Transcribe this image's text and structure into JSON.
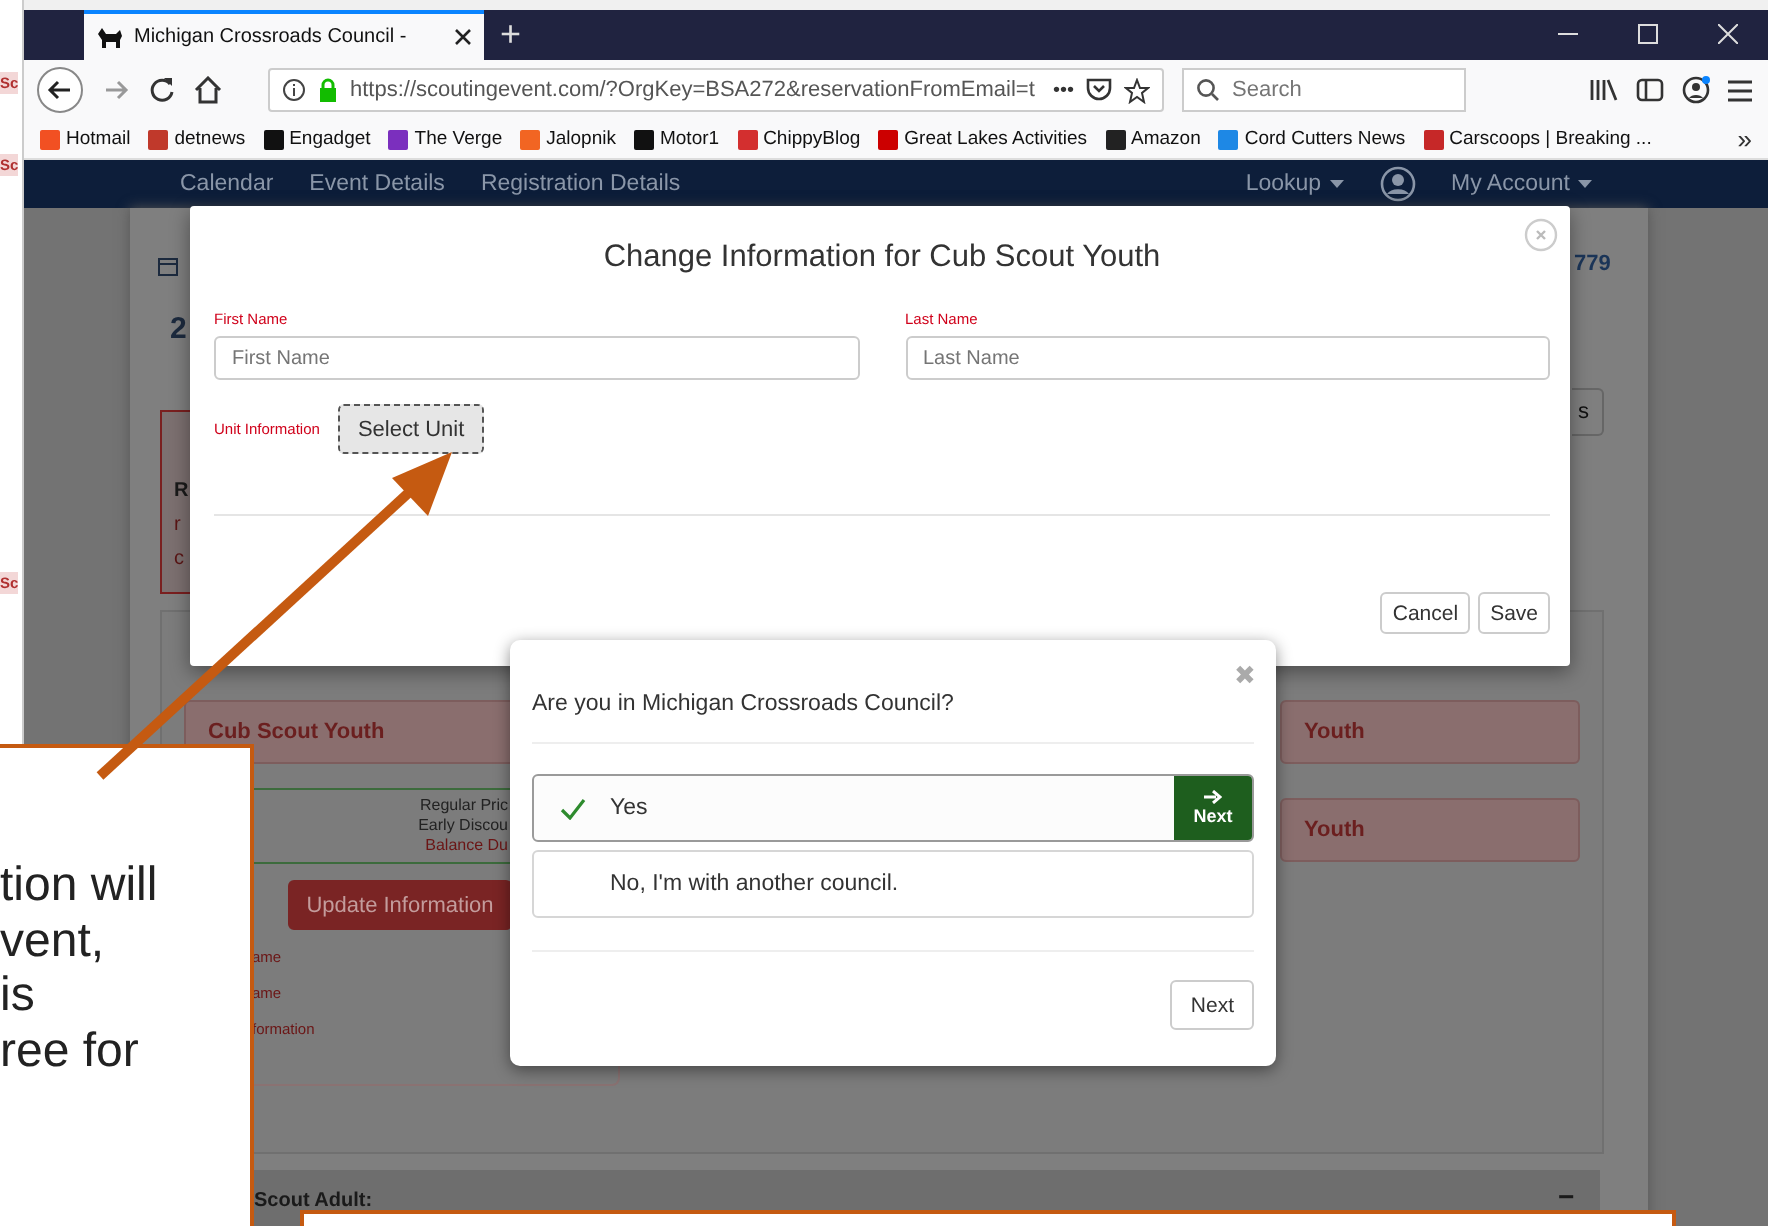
{
  "left_strip": {
    "labels": [
      "Sc",
      "Sc",
      "Sc"
    ]
  },
  "browser": {
    "tab": {
      "title": "Michigan Crossroads Council -",
      "selected": true
    },
    "new_tab": "+",
    "url": "https://scoutingevent.com/?OrgKey=BSA272&reservationFromEmail=t",
    "page_actions": "•••",
    "search": {
      "placeholder": "Search"
    },
    "bookmarks": [
      {
        "label": "Hotmail",
        "color": "#f25022"
      },
      {
        "label": "detnews",
        "color": "#c0392b"
      },
      {
        "label": "Engadget",
        "color": "#111111"
      },
      {
        "label": "The Verge",
        "color": "#7b2fbe"
      },
      {
        "label": "Jalopnik",
        "color": "#f26522"
      },
      {
        "label": "Motor1",
        "color": "#111111"
      },
      {
        "label": "ChippyBlog",
        "color": "#d32f2f"
      },
      {
        "label": "Great Lakes Activities",
        "color": "#cc0000"
      },
      {
        "label": "Amazon",
        "color": "#222222"
      },
      {
        "label": "Cord Cutters News",
        "color": "#1e88e5"
      },
      {
        "label": "Carscoops | Breaking ...",
        "color": "#c62828"
      }
    ],
    "bookmarks_overflow": "»"
  },
  "site_nav": {
    "items": [
      "Calendar",
      "Event Details",
      "Registration Details"
    ],
    "lookup": "Lookup",
    "account": "My Account"
  },
  "background_page": {
    "reservation_number": "779",
    "heading_fragment": "2",
    "button_fragment": "s",
    "alert_fragments": [
      "R",
      "r",
      "c"
    ],
    "participant_cards": [
      {
        "label": "Cub Scout Youth"
      },
      {
        "label": "Youth"
      },
      {
        "label": "Youth"
      }
    ],
    "price_lines": [
      {
        "text": "Regular Pric",
        "kind": "normal"
      },
      {
        "text": "Early Discou",
        "kind": "normal"
      },
      {
        "text": "Balance Du",
        "kind": "due"
      }
    ],
    "update_button": "Update Information",
    "field_labels": [
      "ame",
      "ame",
      "formation"
    ],
    "section_title": "Scout Adult:",
    "collapse": "−"
  },
  "edit_dialog": {
    "title": "Change Information for Cub Scout Youth",
    "fields": [
      {
        "label": "First Name",
        "placeholder": "First Name"
      },
      {
        "label": "Last Name",
        "placeholder": "Last Name"
      }
    ],
    "unit": {
      "label": "Unit Information",
      "button": "Select Unit",
      "focused": true
    },
    "buttons": [
      "Cancel",
      "Save"
    ]
  },
  "council_dialog": {
    "close": "✖",
    "question": "Are you in Michigan Crossroads Council?",
    "options": [
      {
        "label": "Yes",
        "selected": true
      },
      {
        "label": "No, I'm with another council.",
        "selected": false
      }
    ],
    "option_action": "Next",
    "button": "Next"
  },
  "callout": {
    "lines": [
      "tion will",
      "vent,",
      "is",
      "ree for"
    ]
  }
}
